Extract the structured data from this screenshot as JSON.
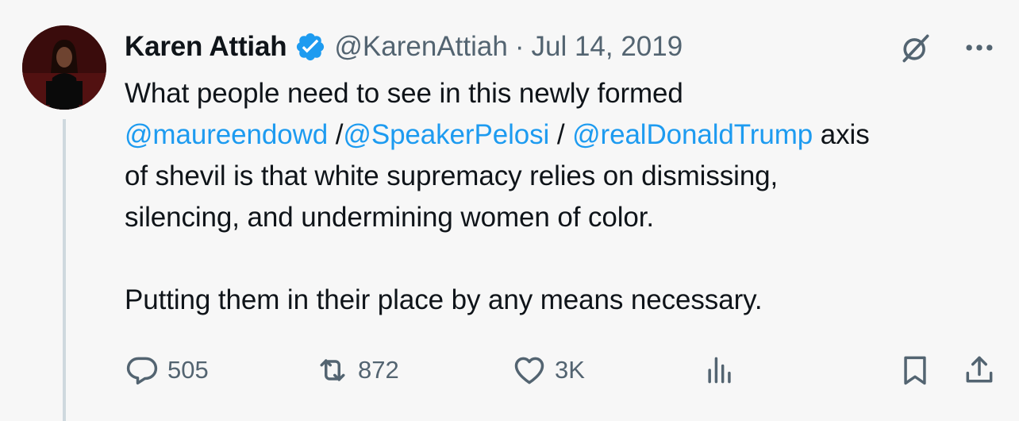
{
  "author": {
    "name": "Karen Attiah",
    "handle": "@KarenAttiah",
    "date": "Jul 14, 2019",
    "separator": "·"
  },
  "tweet": {
    "line1": "What people need to see in this newly formed",
    "mention1": "@maureendowd",
    "slash1": " /",
    "mention2": "@SpeakerPelosi",
    "slash2": " / ",
    "mention3": "@realDonaldTrump",
    "line2_end": " axis",
    "line3": "of shevil is that white supremacy relies on dismissing,",
    "line4": "silencing, and undermining women of color.",
    "line5": "Putting them in their place by any means necessary."
  },
  "actions": {
    "reply_count": "505",
    "retweet_count": "872",
    "like_count": "3K"
  },
  "icons": {
    "verified": "verified-badge-icon",
    "grok": "grok-icon",
    "more": "more-icon",
    "reply": "reply-icon",
    "retweet": "retweet-icon",
    "like": "heart-icon",
    "views": "views-icon",
    "bookmark": "bookmark-icon",
    "share": "share-icon"
  },
  "colors": {
    "background": "#f7f7f7",
    "text": "#0f1419",
    "secondary": "#536471",
    "link": "#1d9bf0",
    "thread_line": "#cfd9de"
  }
}
